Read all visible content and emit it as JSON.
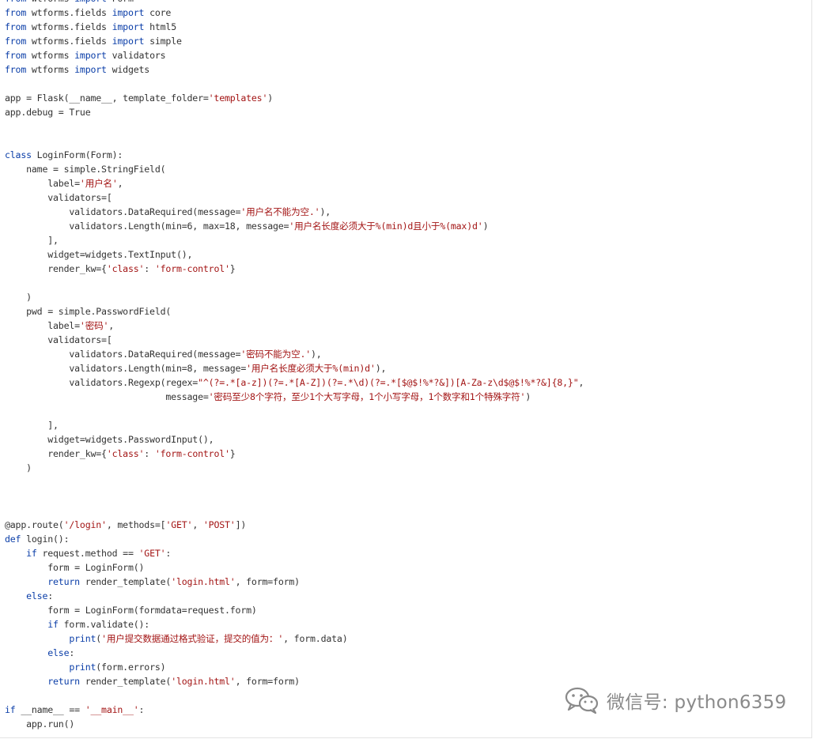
{
  "code_lines": [
    [
      {
        "t": "from",
        "c": "kw"
      },
      {
        "t": " wtforms "
      },
      {
        "t": "import",
        "c": "kw"
      },
      {
        "t": " Form"
      }
    ],
    [
      {
        "t": "from",
        "c": "kw"
      },
      {
        "t": " wtforms.fields "
      },
      {
        "t": "import",
        "c": "kw"
      },
      {
        "t": " core"
      }
    ],
    [
      {
        "t": "from",
        "c": "kw"
      },
      {
        "t": " wtforms.fields "
      },
      {
        "t": "import",
        "c": "kw"
      },
      {
        "t": " html5"
      }
    ],
    [
      {
        "t": "from",
        "c": "kw"
      },
      {
        "t": " wtforms.fields "
      },
      {
        "t": "import",
        "c": "kw"
      },
      {
        "t": " simple"
      }
    ],
    [
      {
        "t": "from",
        "c": "kw"
      },
      {
        "t": " wtforms "
      },
      {
        "t": "import",
        "c": "kw"
      },
      {
        "t": " validators"
      }
    ],
    [
      {
        "t": "from",
        "c": "kw"
      },
      {
        "t": " wtforms "
      },
      {
        "t": "import",
        "c": "kw"
      },
      {
        "t": " widgets"
      }
    ],
    [],
    [
      {
        "t": "app = Flask(__name__, template_folder="
      },
      {
        "t": "'templates'",
        "c": "str"
      },
      {
        "t": ")"
      }
    ],
    [
      {
        "t": "app.debug = True"
      }
    ],
    [],
    [],
    [
      {
        "t": "class",
        "c": "kw"
      },
      {
        "t": " LoginForm(Form):"
      }
    ],
    [
      {
        "t": "    name = simple.StringField("
      }
    ],
    [
      {
        "t": "        label="
      },
      {
        "t": "'用户名'",
        "c": "str"
      },
      {
        "t": ","
      }
    ],
    [
      {
        "t": "        validators=["
      }
    ],
    [
      {
        "t": "            validators.DataRequired(message="
      },
      {
        "t": "'用户名不能为空.'",
        "c": "str"
      },
      {
        "t": "),"
      }
    ],
    [
      {
        "t": "            validators.Length(min=6, max=18, message="
      },
      {
        "t": "'用户名长度必须大于%(min)d且小于%(max)d'",
        "c": "str"
      },
      {
        "t": ")"
      }
    ],
    [
      {
        "t": "        ],"
      }
    ],
    [
      {
        "t": "        widget=widgets.TextInput(),"
      }
    ],
    [
      {
        "t": "        render_kw={"
      },
      {
        "t": "'class'",
        "c": "str"
      },
      {
        "t": ": "
      },
      {
        "t": "'form-control'",
        "c": "str"
      },
      {
        "t": "}"
      }
    ],
    [],
    [
      {
        "t": "    )"
      }
    ],
    [
      {
        "t": "    pwd = simple.PasswordField("
      }
    ],
    [
      {
        "t": "        label="
      },
      {
        "t": "'密码'",
        "c": "str"
      },
      {
        "t": ","
      }
    ],
    [
      {
        "t": "        validators=["
      }
    ],
    [
      {
        "t": "            validators.DataRequired(message="
      },
      {
        "t": "'密码不能为空.'",
        "c": "str"
      },
      {
        "t": "),"
      }
    ],
    [
      {
        "t": "            validators.Length(min=8, message="
      },
      {
        "t": "'用户名长度必须大于%(min)d'",
        "c": "str"
      },
      {
        "t": "),"
      }
    ],
    [
      {
        "t": "            validators.Regexp(regex="
      },
      {
        "t": "\"^(?=.*[a-z])(?=.*[A-Z])(?=.*\\d)(?=.*[$@$!%*?&])[A-Za-z\\d$@$!%*?&]{8,}\"",
        "c": "str"
      },
      {
        "t": ","
      }
    ],
    [
      {
        "t": "                              message="
      },
      {
        "t": "'密码至少8个字符，至少1个大写字母，1个小写字母，1个数字和1个特殊字符'",
        "c": "str"
      },
      {
        "t": ")"
      }
    ],
    [],
    [
      {
        "t": "        ],"
      }
    ],
    [
      {
        "t": "        widget=widgets.PasswordInput(),"
      }
    ],
    [
      {
        "t": "        render_kw={"
      },
      {
        "t": "'class'",
        "c": "str"
      },
      {
        "t": ": "
      },
      {
        "t": "'form-control'",
        "c": "str"
      },
      {
        "t": "}"
      }
    ],
    [
      {
        "t": "    )"
      }
    ],
    [],
    [],
    [],
    [
      {
        "t": "@app.route(",
        "c": "dec"
      },
      {
        "t": "'/login'",
        "c": "str"
      },
      {
        "t": ", methods=["
      },
      {
        "t": "'GET'",
        "c": "str"
      },
      {
        "t": ", "
      },
      {
        "t": "'POST'",
        "c": "str"
      },
      {
        "t": "])"
      }
    ],
    [
      {
        "t": "def",
        "c": "kw"
      },
      {
        "t": " login():"
      }
    ],
    [
      {
        "t": "    "
      },
      {
        "t": "if",
        "c": "kw"
      },
      {
        "t": " request.method == "
      },
      {
        "t": "'GET'",
        "c": "str"
      },
      {
        "t": ":"
      }
    ],
    [
      {
        "t": "        form = LoginForm()"
      }
    ],
    [
      {
        "t": "        "
      },
      {
        "t": "return",
        "c": "kw"
      },
      {
        "t": " render_template("
      },
      {
        "t": "'login.html'",
        "c": "str"
      },
      {
        "t": ", form=form)"
      }
    ],
    [
      {
        "t": "    "
      },
      {
        "t": "else",
        "c": "kw"
      },
      {
        "t": ":"
      }
    ],
    [
      {
        "t": "        form = LoginForm(formdata=request.form)"
      }
    ],
    [
      {
        "t": "        "
      },
      {
        "t": "if",
        "c": "kw"
      },
      {
        "t": " form.validate():"
      }
    ],
    [
      {
        "t": "            "
      },
      {
        "t": "print",
        "c": "kw"
      },
      {
        "t": "("
      },
      {
        "t": "'用户提交数据通过格式验证，提交的值为：'",
        "c": "str"
      },
      {
        "t": ", form.data)"
      }
    ],
    [
      {
        "t": "        "
      },
      {
        "t": "else",
        "c": "kw"
      },
      {
        "t": ":"
      }
    ],
    [
      {
        "t": "            "
      },
      {
        "t": "print",
        "c": "kw"
      },
      {
        "t": "(form.errors)"
      }
    ],
    [
      {
        "t": "        "
      },
      {
        "t": "return",
        "c": "kw"
      },
      {
        "t": " render_template("
      },
      {
        "t": "'login.html'",
        "c": "str"
      },
      {
        "t": ", form=form)"
      }
    ],
    [],
    [
      {
        "t": "if",
        "c": "kw"
      },
      {
        "t": " __name__ == "
      },
      {
        "t": "'__main__'",
        "c": "str"
      },
      {
        "t": ":"
      }
    ],
    [
      {
        "t": "    app.run()"
      }
    ]
  ],
  "watermark": {
    "text": "微信号: python6359",
    "icon": "wechat-icon"
  }
}
